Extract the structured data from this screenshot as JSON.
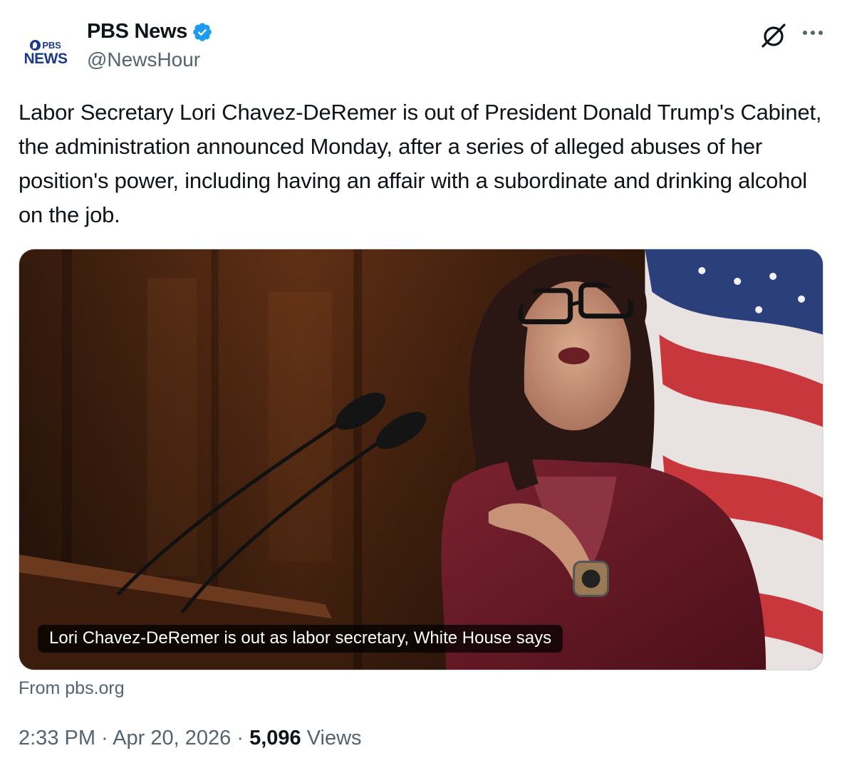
{
  "author": {
    "display_name": "PBS News",
    "handle": "@NewsHour",
    "avatar_logo_top": "PBS",
    "avatar_logo_bottom": "NEWS",
    "verified": true,
    "verified_color": "#1d9bf0"
  },
  "header_icons": {
    "grok": "grok-icon",
    "more": "more-options-icon"
  },
  "tweet": {
    "text": "Labor Secretary Lori Chavez-DeRemer is out of President Donald Trump's Cabinet, the administration announced Monday, after a series of alleged abuses of her position's power, including having an affair with a subordinate and drinking alcohol on the job."
  },
  "card": {
    "caption": "Lori Chavez-DeRemer is out as labor secretary, White House says",
    "source": "From pbs.org"
  },
  "meta": {
    "time": "2:33 PM",
    "separator": "·",
    "date": "Apr 20, 2026",
    "views_count": "5,096",
    "views_label": "Views"
  }
}
